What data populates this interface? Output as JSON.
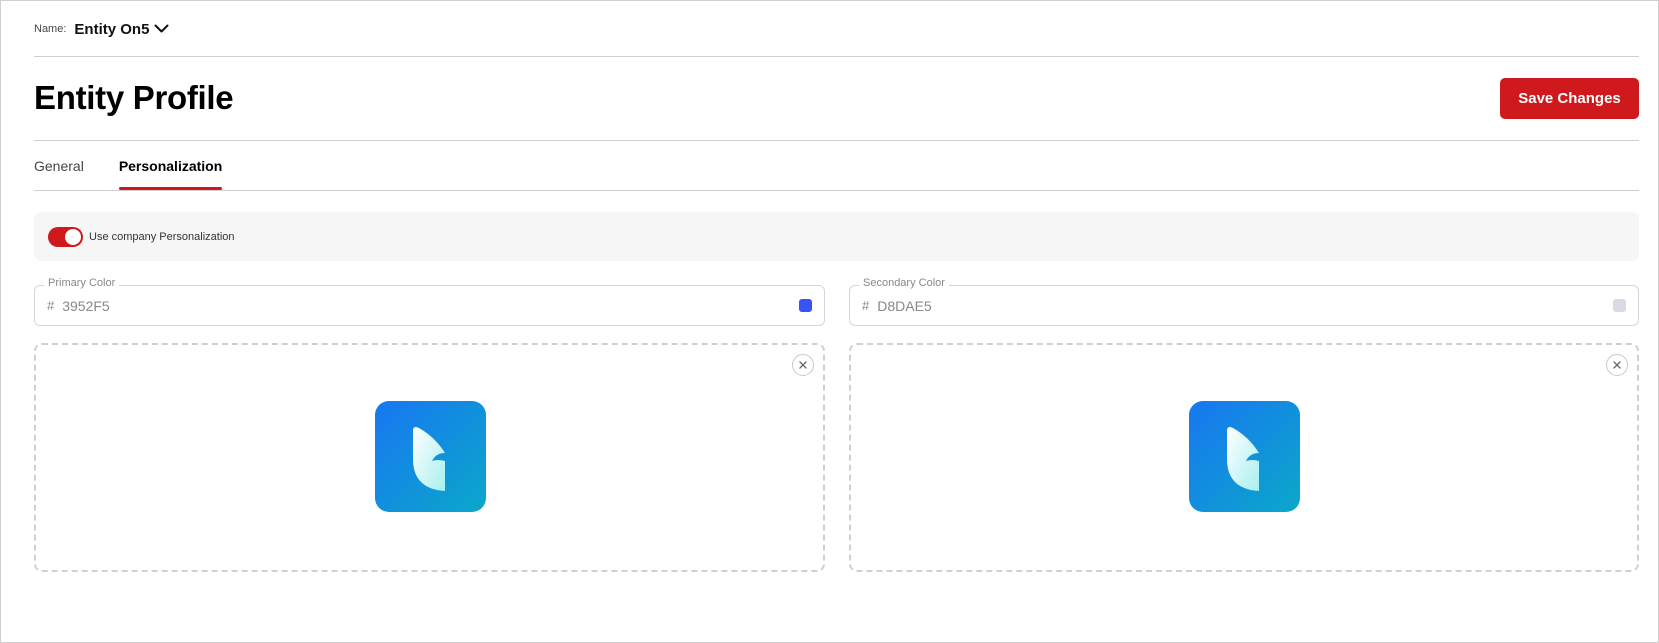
{
  "header": {
    "name_label": "Name:",
    "name_value": "Entity On5",
    "title": "Entity Profile",
    "save_label": "Save Changes"
  },
  "tabs": [
    {
      "label": "General",
      "active": false
    },
    {
      "label": "Personalization",
      "active": true
    }
  ],
  "personalization": {
    "toggle_label": "Use company Personalization",
    "toggle_on": true,
    "primary": {
      "label": "Primary Color",
      "hash": "#",
      "value": "3952F5",
      "swatch": "#3952F5"
    },
    "secondary": {
      "label": "Secondary Color",
      "hash": "#",
      "value": "D8DAE5",
      "swatch": "#D8DAE5"
    }
  },
  "colors": {
    "accent": "#d0191c",
    "logo_gradient_start": "#1877f2",
    "logo_gradient_end": "#0aa8c9"
  },
  "icons": {
    "name_dropdown": "chevron-down-icon",
    "remove_image": "close-icon",
    "logo": "app-logo-icon"
  }
}
